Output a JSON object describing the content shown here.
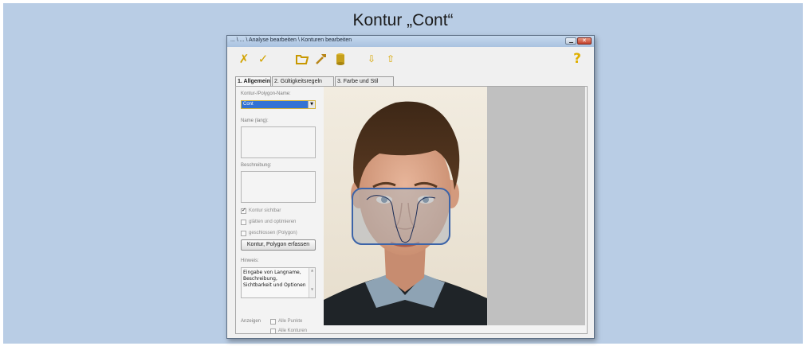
{
  "slide": {
    "title": "Kontur „Cont“"
  },
  "window": {
    "title": "... \\ ... \\ Analyse bearbeiten \\ Konturen bearbeiten"
  },
  "toolbar": {
    "icons": [
      "cancel-icon",
      "confirm-icon",
      "open-folder-icon",
      "tool-hammer-icon",
      "database-icon",
      "move-down-icon",
      "move-up-icon",
      "help-icon"
    ],
    "accent_color": "#d2a300"
  },
  "tabs": [
    {
      "label": "1. Allgemein",
      "active": true
    },
    {
      "label": "2. Gültigkeitsregeln",
      "active": false
    },
    {
      "label": "3. Farbe und Stil",
      "active": false
    }
  ],
  "form": {
    "contour_label": "Kontur-/Polygon-Name:",
    "contour_value": "Cont",
    "name_label": "Name (lang):",
    "name_value": "",
    "desc_label": "Beschreibung:",
    "desc_value": "",
    "checkboxes": [
      {
        "label": "Kontur sichtbar",
        "checked": true
      },
      {
        "label": "glätten und optimieren",
        "checked": false
      },
      {
        "label": "geschlossen (Polygon)",
        "checked": false
      }
    ],
    "capture_button": "Kontur, Polygon erfassen",
    "hint_label": "Hinweis:",
    "hint_text": "Eingabe von Langname, Beschreibung, Sichtbarkeit und Optionen",
    "show_label": "Anzeigen",
    "show_options": [
      {
        "label": "Alle Punkte",
        "checked": false
      },
      {
        "label": "Alle Konturen",
        "checked": false
      }
    ]
  },
  "colors": {
    "slide_bg": "#b9cde5",
    "selection": "#3272d4",
    "overlay_border": "#3c64a8"
  }
}
